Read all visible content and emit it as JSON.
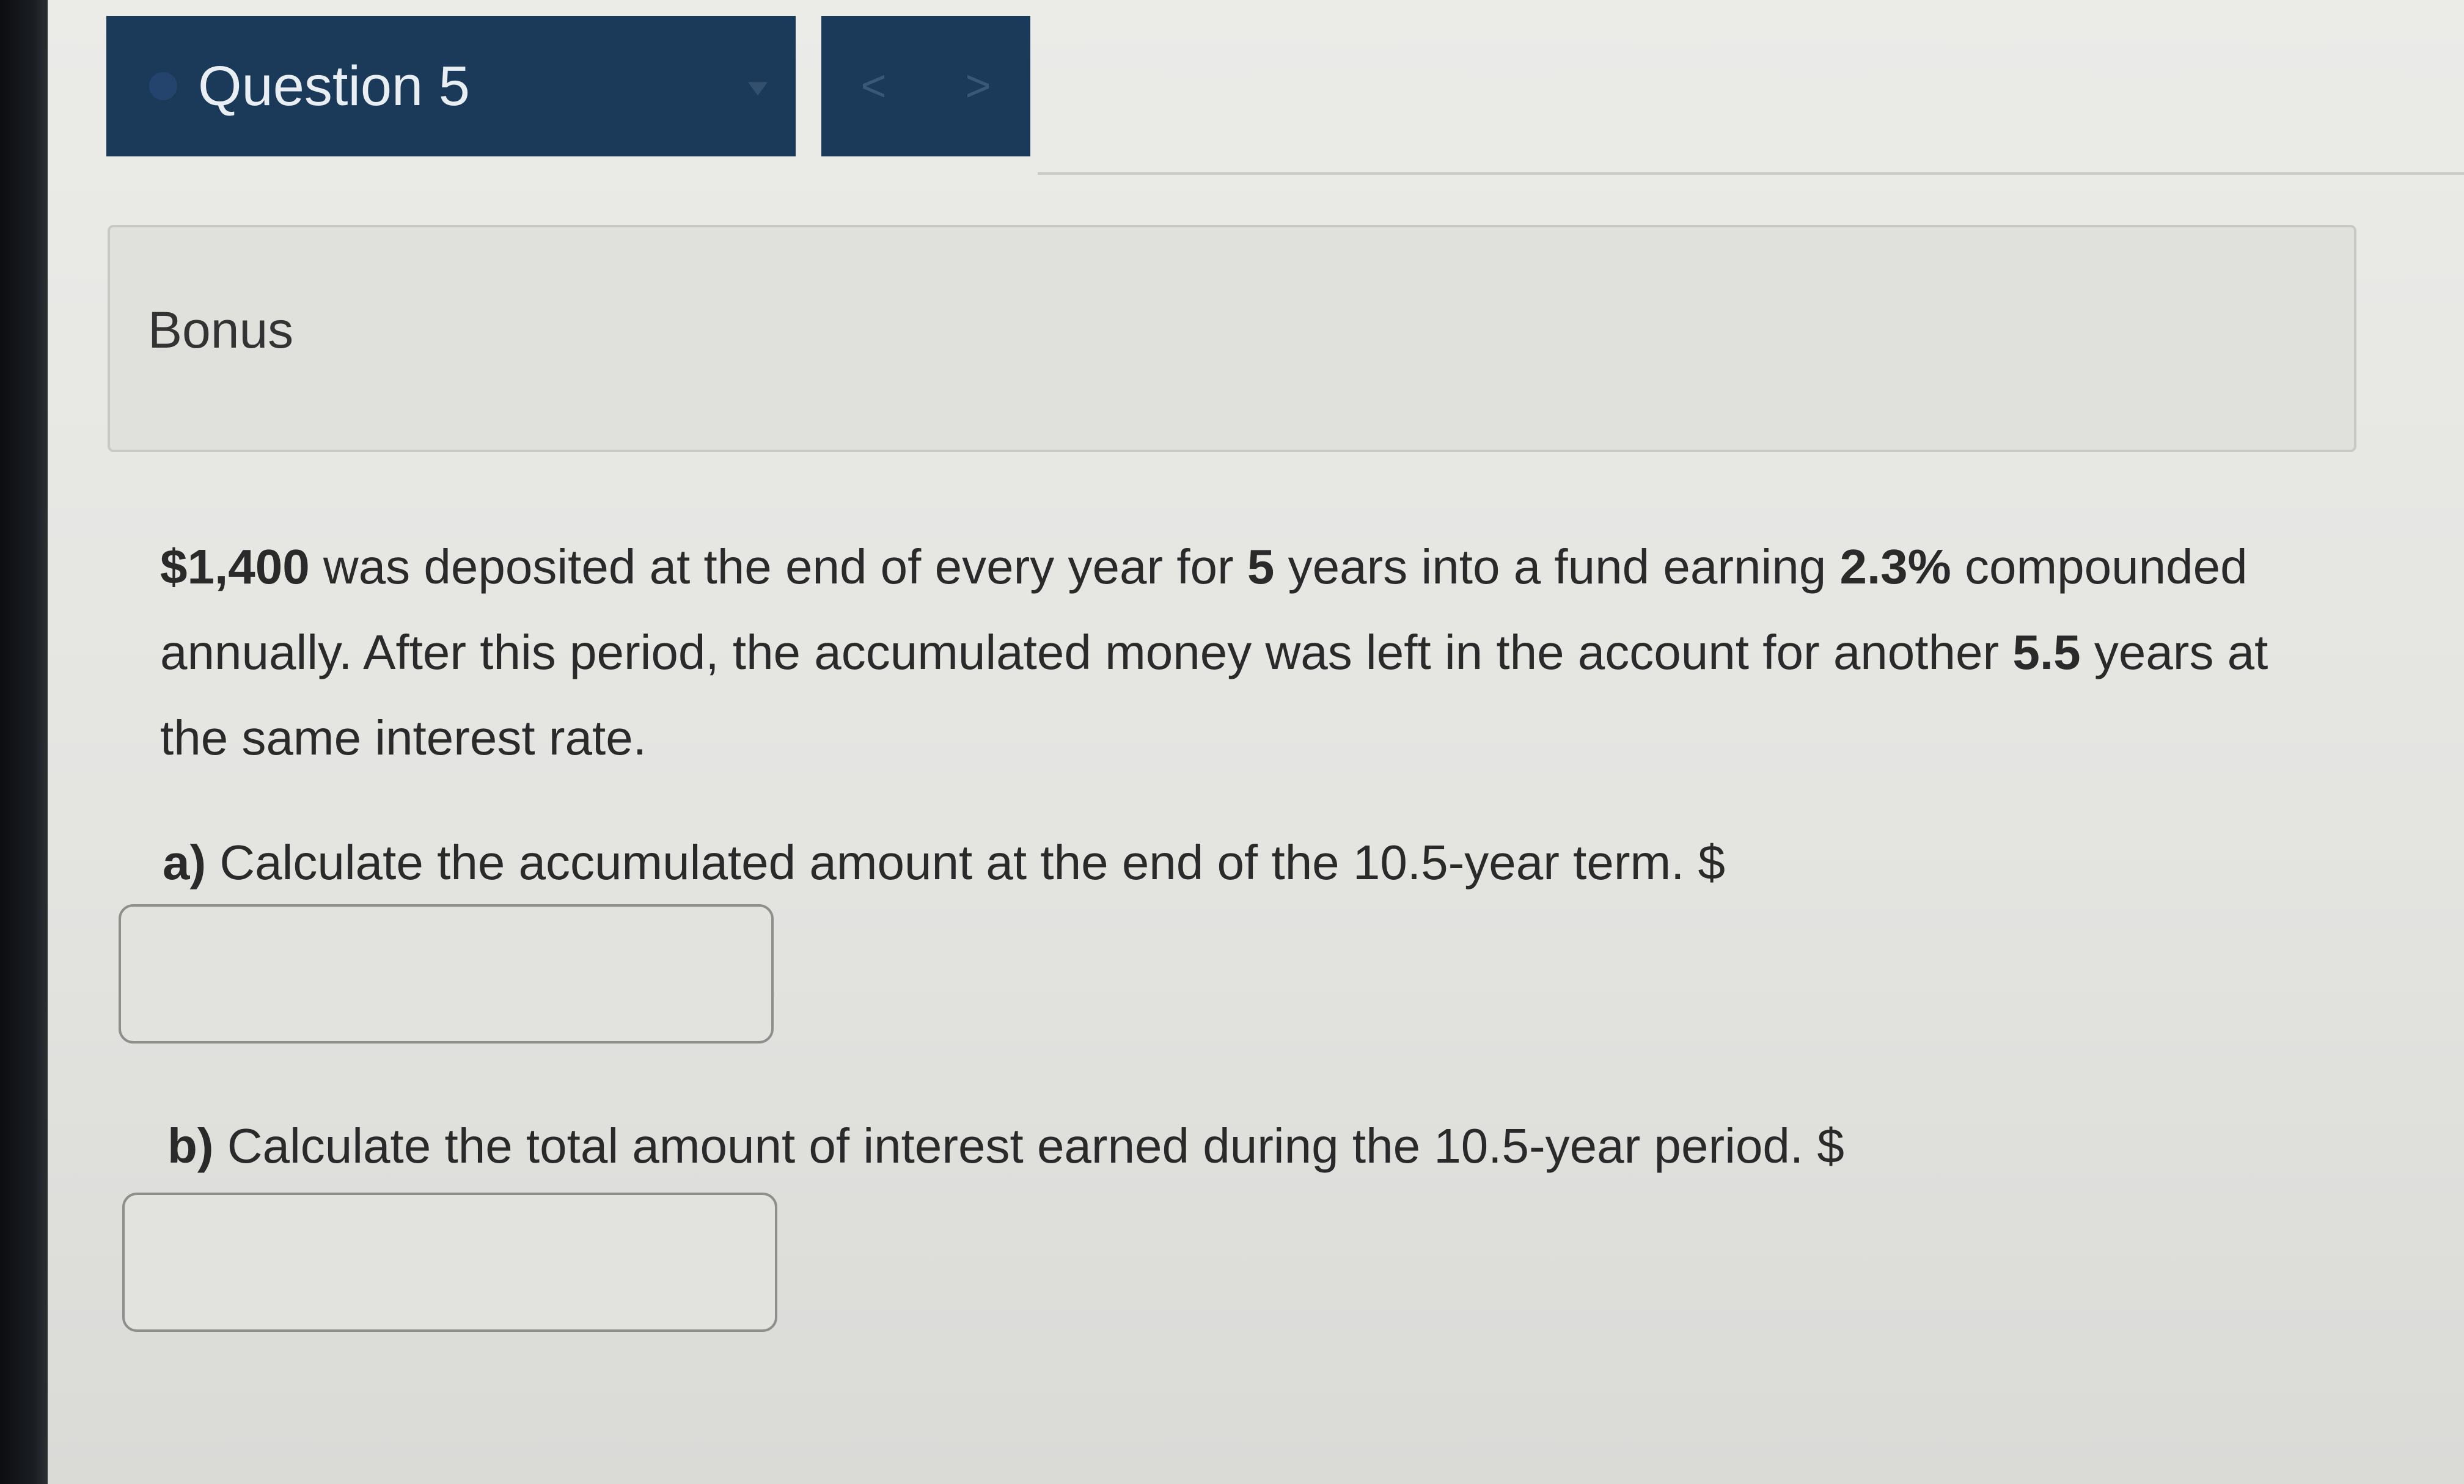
{
  "question_selector": {
    "label": "Question 5"
  },
  "nav": {
    "prev": "<",
    "next": ">"
  },
  "section": {
    "title": "Bonus"
  },
  "problem": {
    "amount": "$1,400",
    "t1": " was deposited at the end of every year for ",
    "years": "5",
    "t2": " years into a fund earning ",
    "rate": "2.3%",
    "t3": " compounded annually. After this period, the accumulated money was left in the account for another ",
    "extra_years": "5.5",
    "t4": " years at the same interest rate."
  },
  "part_a": {
    "letter": "a)",
    "text": " Calculate the accumulated amount at the end of the 10.5-year term. $",
    "value": ""
  },
  "part_b": {
    "letter": "b)",
    "text": " Calculate the total amount of interest earned during the 10.5-year period. $",
    "value": ""
  }
}
